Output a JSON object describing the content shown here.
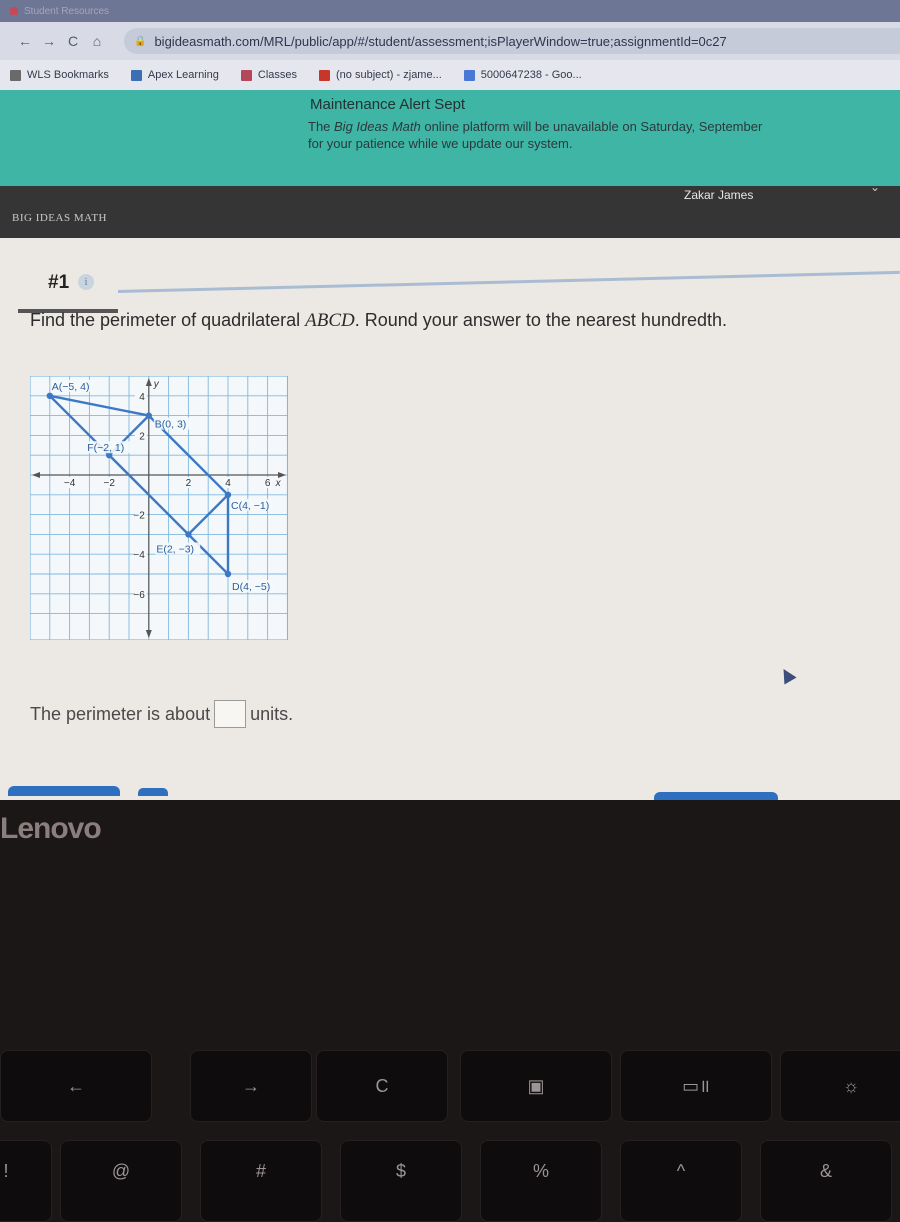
{
  "browser": {
    "tab_title": "Student Resources",
    "url": "bigideasmath.com/MRL/public/app/#/student/assessment;isPlayerWindow=true;assignmentId=0c27",
    "nav": {
      "back": "←",
      "forward": "→",
      "reload": "C",
      "home": "⌂"
    },
    "bookmarks": [
      {
        "label": "WLS Bookmarks",
        "icon": "folder-icon",
        "color": "#6a6a6a"
      },
      {
        "label": "Apex Learning",
        "icon": "apex-icon",
        "color": "#3b6fb5"
      },
      {
        "label": "Classes",
        "icon": "classroom-icon",
        "color": "#b5475a"
      },
      {
        "label": "(no subject) - zjame...",
        "icon": "gmail-icon",
        "color": "#c7352b"
      },
      {
        "label": "5000647238 - Goo...",
        "icon": "google-icon",
        "color": "#4a78d6"
      }
    ]
  },
  "alert": {
    "title": "Maintenance Alert Sept",
    "body_prefix": "The ",
    "body_italic": "Big Ideas Math",
    "body_suffix": " online platform will be unavailable on Saturday, September",
    "body_line2": "for your patience while we update our system."
  },
  "app": {
    "brand": "BIG IDEAS MATH",
    "user_name": "Zakar James",
    "user_menu_icon": "chevron-down-icon"
  },
  "question": {
    "number": "#1",
    "info_icon": "i",
    "prompt_before": "Find the perimeter of quadrilateral ",
    "prompt_italic": "ABCD",
    "prompt_after": ". Round your answer to the nearest hundredth.",
    "answer_prefix": "The perimeter is about",
    "answer_value": "",
    "answer_suffix": "units."
  },
  "figure": {
    "x_range": [
      -6,
      7
    ],
    "y_range": [
      -7,
      5
    ],
    "x_ticks": [
      {
        "v": -4,
        "t": "−4"
      },
      {
        "v": -2,
        "t": "−2"
      },
      {
        "v": 2,
        "t": "2"
      },
      {
        "v": 4,
        "t": "4"
      },
      {
        "v": 6,
        "t": "6"
      }
    ],
    "y_ticks": [
      {
        "v": 4,
        "t": "4"
      },
      {
        "v": 2,
        "t": "2"
      },
      {
        "v": -2,
        "t": "−2"
      },
      {
        "v": -4,
        "t": "−4"
      },
      {
        "v": -6,
        "t": "−6"
      }
    ],
    "x_axis_label": "x",
    "y_axis_label": "y",
    "points": [
      {
        "name": "A",
        "x": -5,
        "y": 4,
        "label": "A(−5, 4)"
      },
      {
        "name": "B",
        "x": 0,
        "y": 3,
        "label": "B(0, 3)"
      },
      {
        "name": "C",
        "x": 4,
        "y": -1,
        "label": "C(4, −1)"
      },
      {
        "name": "D",
        "x": 4,
        "y": -5,
        "label": "D(4, −5)"
      },
      {
        "name": "E",
        "x": 2,
        "y": -3,
        "label": "E(2, −3)"
      },
      {
        "name": "F",
        "x": -2,
        "y": 1,
        "label": "F(−2, 1)"
      }
    ],
    "segments": [
      [
        "A",
        "B"
      ],
      [
        "B",
        "C"
      ],
      [
        "C",
        "D"
      ],
      [
        "D",
        "A"
      ],
      [
        "B",
        "F"
      ],
      [
        "C",
        "E"
      ]
    ],
    "color": "#3b79c7",
    "grid_color": "#7fb8df"
  },
  "laptop": {
    "brand": "Lenovo",
    "keys_top": [
      "←",
      "→",
      "C",
      "▣",
      "▭॥",
      "☼"
    ],
    "keys_bottom": [
      "!",
      "@",
      "#",
      "$",
      "%",
      "^",
      "&"
    ]
  }
}
